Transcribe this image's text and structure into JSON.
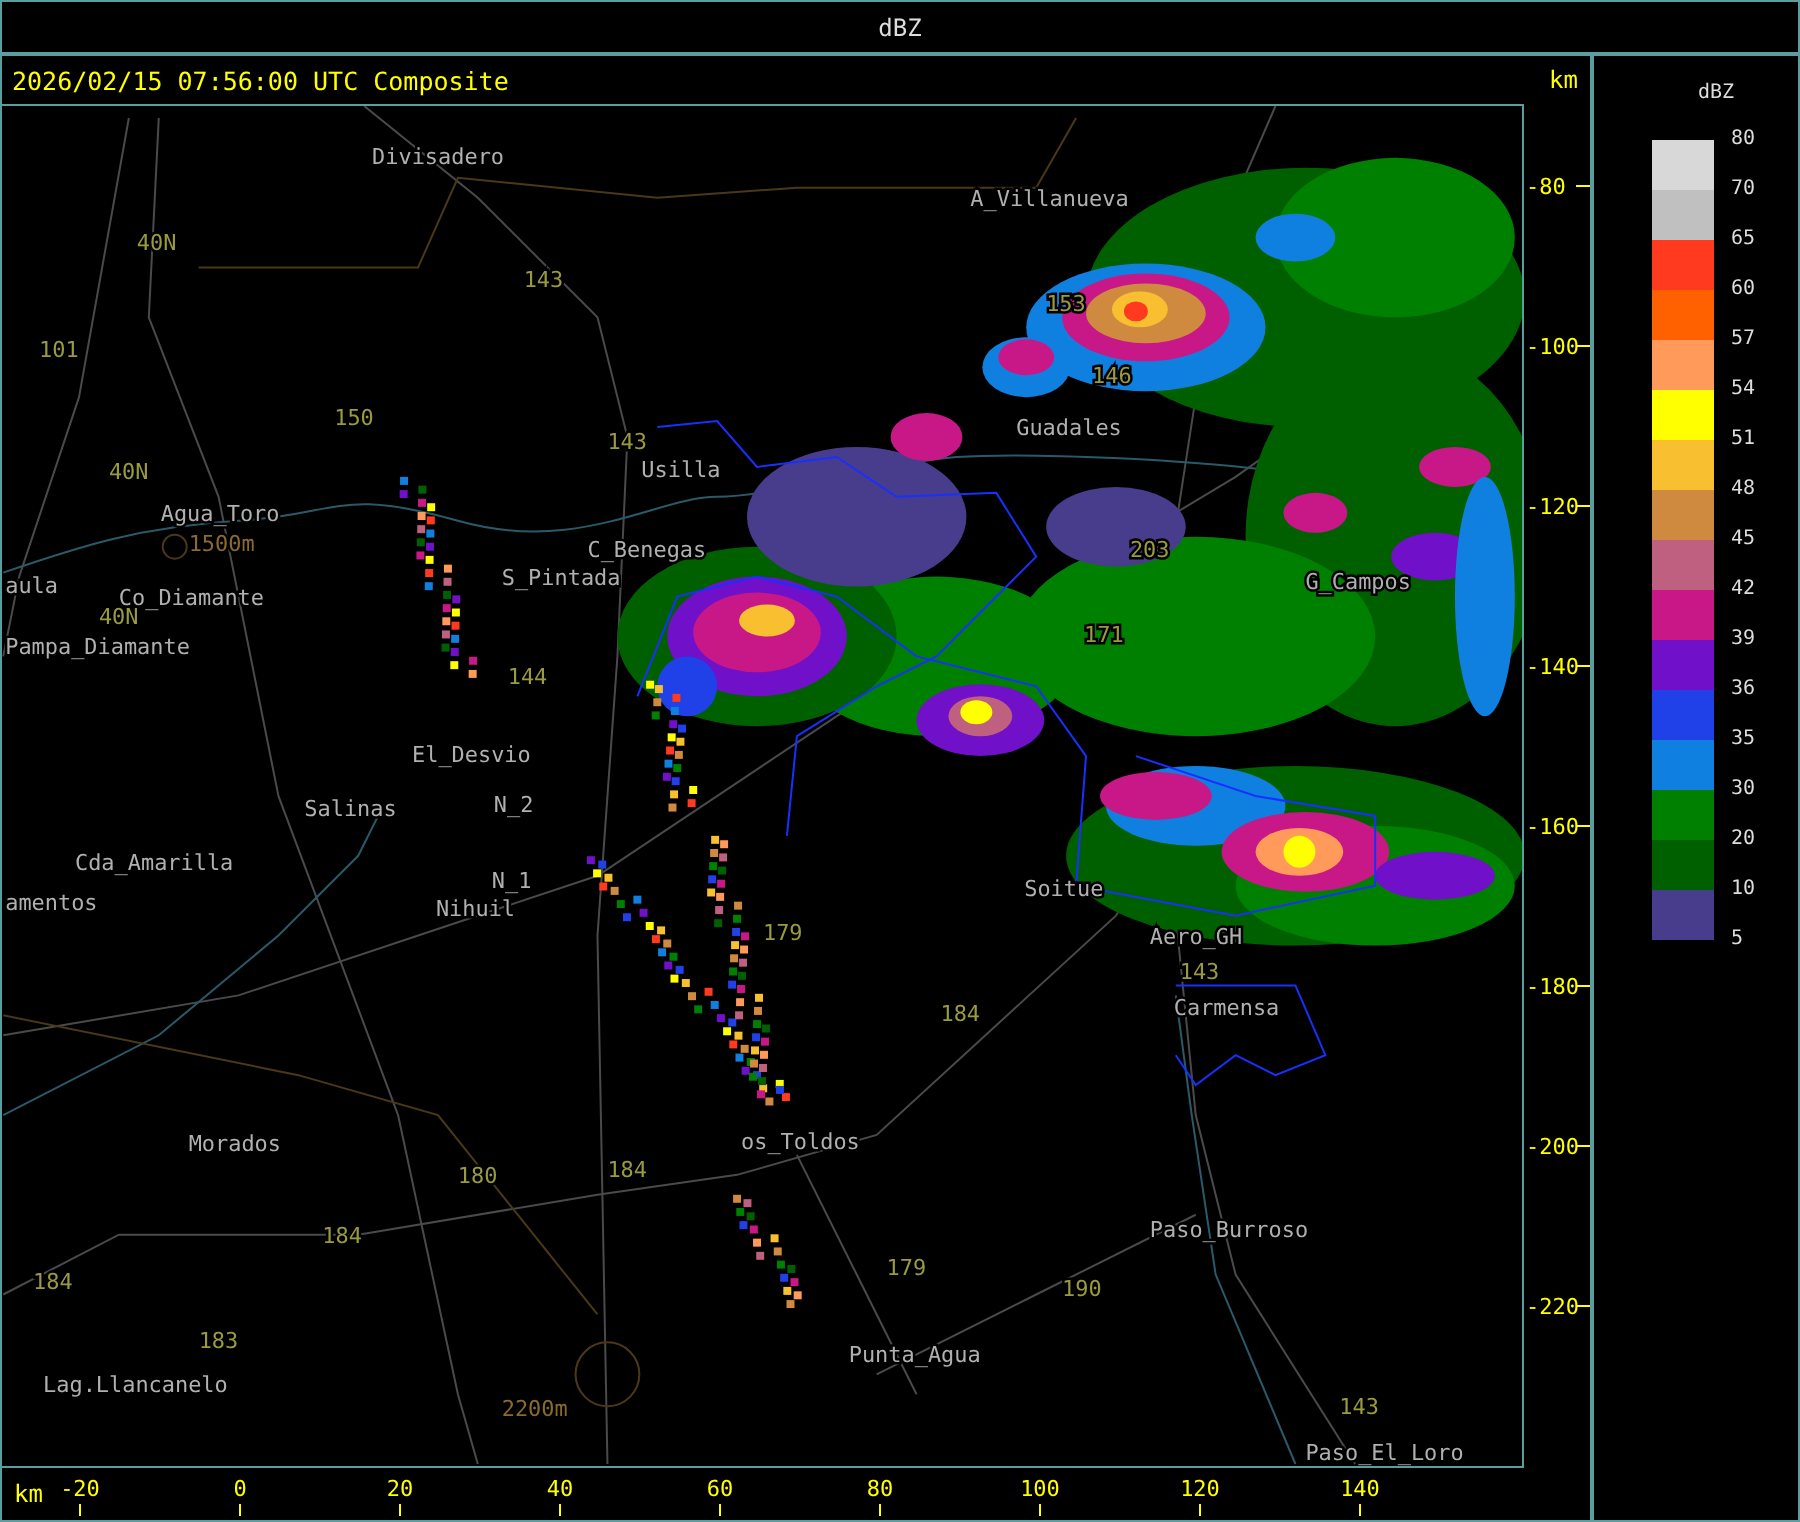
{
  "window": {
    "title": "dBZ"
  },
  "header": {
    "timestamp": "2026/02/15 07:56:00 UTC Composite",
    "unit": "km"
  },
  "map": {
    "places": [
      "Divisadero",
      "A_Villanueva",
      "Agua_Toro",
      "Co_Diamante",
      "aula",
      "Pampa_Diamante",
      "Usilla",
      "S_Pintada",
      "C_Benegas",
      "Guadales",
      "G_Campos",
      "El_Desvio",
      "Salinas",
      "N_2",
      "N_1",
      "Nihuil",
      "Cda_Amarilla",
      "amentos",
      "Morados",
      "os_Toldos",
      "Lag.Llancanelo",
      "Punta_Agua",
      "Soitue",
      "Aero_GH",
      "Carmensa",
      "Paso_Burroso",
      "Paso_El_Loro"
    ],
    "route_numbers": [
      "40N",
      "101",
      "143",
      "150",
      "40N",
      "143",
      "40N",
      "144",
      "180",
      "184",
      "184",
      "184",
      "183",
      "179",
      "179",
      "190",
      "184",
      "143",
      "143",
      "171",
      "203",
      "146",
      "153"
    ],
    "elevations": [
      "1500m",
      "2200m"
    ]
  },
  "y_axis": {
    "ticks": [
      "-80",
      "-100",
      "-120",
      "-140",
      "-160",
      "-180",
      "-200",
      "-220"
    ]
  },
  "x_axis": {
    "unit": "km",
    "ticks": [
      "-20",
      "0",
      "20",
      "40",
      "60",
      "80",
      "100",
      "120",
      "140"
    ]
  },
  "legend": {
    "title": "dBZ",
    "labels": [
      "80",
      "70",
      "65",
      "60",
      "57",
      "54",
      "51",
      "48",
      "45",
      "42",
      "39",
      "36",
      "35",
      "30",
      "20",
      "10",
      "5"
    ],
    "bands": [
      {
        "color": "#d8d8d8"
      },
      {
        "color": "#c0c0c0"
      },
      {
        "color": "#ff3a1e"
      },
      {
        "color": "#ff6000"
      },
      {
        "color": "#ff9a5a"
      },
      {
        "color": "#ffff00"
      },
      {
        "color": "#f8c030"
      },
      {
        "color": "#d08a40"
      },
      {
        "color": "#c06080"
      },
      {
        "color": "#c81888"
      },
      {
        "color": "#7010c8"
      },
      {
        "color": "#2040e8"
      },
      {
        "color": "#1080e0"
      },
      {
        "color": "#008000"
      },
      {
        "color": "#006000"
      },
      {
        "color": "#483c8c"
      }
    ]
  }
}
